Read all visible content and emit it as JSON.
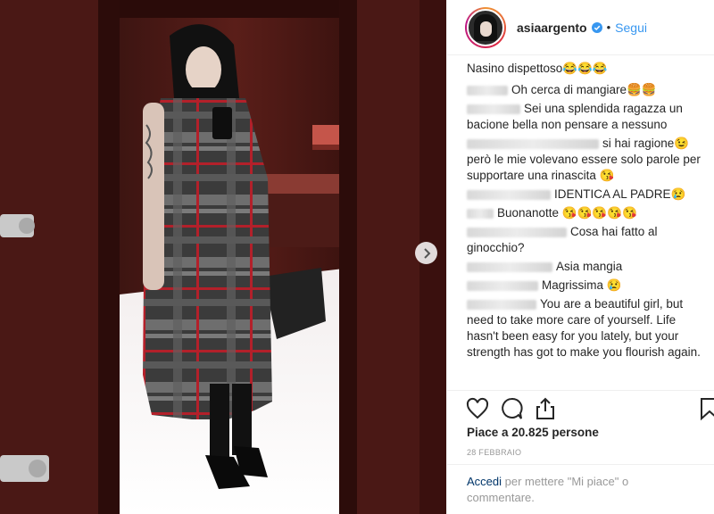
{
  "post": {
    "username": "asiaargento",
    "follow_label": "Segui",
    "separator": "•",
    "caption": "Nasino dispettoso😂😂😂",
    "comments": [
      {
        "text": "Oh cerca di mangiare🍔🍔"
      },
      {
        "text": "Sei una splendida ragazza un bacione bella non pensare a nessuno"
      },
      {
        "text": "si hai ragione😉 però le mie volevano essere solo parole per supportare una rinascita 😘"
      },
      {
        "text": "IDENTICA AL PADRE😢"
      },
      {
        "text": "Buonanotte 😘😘😘😘😘"
      },
      {
        "text": "Cosa hai fatto al ginocchio?"
      },
      {
        "text": "Asia mangia"
      },
      {
        "text": "Magrissima 😢"
      },
      {
        "text": "You are a beautiful girl, but need to take more care of yourself. Life hasn't been easy for you lately, but your strength has got to make you flourish again."
      }
    ],
    "likes_text": "Piace a 20.825 persone",
    "date_text": "28 FEBBRAIO",
    "login_link": "Accedi",
    "login_text": " per mettere \"Mi piace\" o commentare."
  },
  "icons": {
    "verified": "verified-badge-icon",
    "like": "heart-icon",
    "comment": "comment-bubble-icon",
    "share": "share-icon",
    "save": "bookmark-icon",
    "next": "chevron-right-icon"
  },
  "colors": {
    "link_blue": "#3897f0",
    "text": "#262626",
    "muted": "#999999",
    "coat_grey": "#3c3c3c",
    "coat_red": "#b3202a"
  }
}
